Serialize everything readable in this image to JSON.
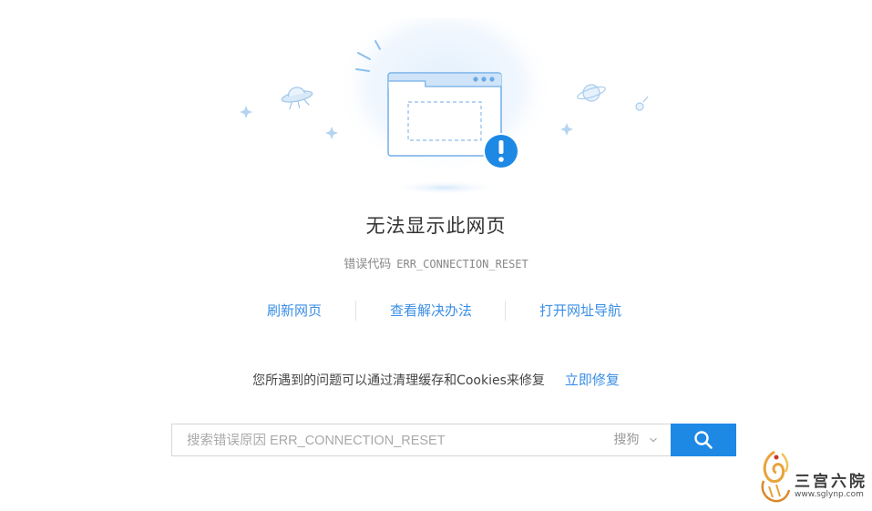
{
  "error_page": {
    "title": "无法显示此网页",
    "error_code_label": "错误代码",
    "error_code": "ERR_CONNECTION_RESET",
    "actions": [
      {
        "label": "刷新网页"
      },
      {
        "label": "查看解决办法"
      },
      {
        "label": "打开网址导航"
      }
    ],
    "fix_hint": "您所遇到的问题可以通过清理缓存和Cookies来修复",
    "fix_link": "立即修复"
  },
  "search": {
    "placeholder": "搜索错误原因 ERR_CONNECTION_RESET",
    "engine": "搜狗"
  },
  "watermark": {
    "text": "三宫六院",
    "url": "www.sglynp.com"
  },
  "colors": {
    "accent": "#1e88e5",
    "link": "#3a8ee6",
    "warning_badge": "#1e88e5"
  }
}
